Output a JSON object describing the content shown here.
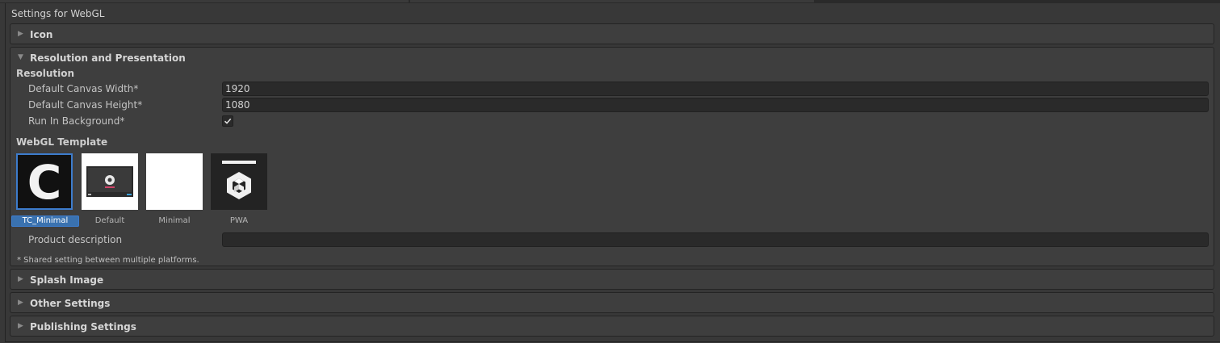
{
  "window_title": "Settings for WebGL",
  "sections": {
    "icon": {
      "title": "Icon",
      "expanded": false
    },
    "resolution": {
      "title": "Resolution and Presentation",
      "expanded": true,
      "resolution_heading": "Resolution",
      "canvas_width_label": "Default Canvas Width*",
      "canvas_width_value": "1920",
      "canvas_height_label": "Default Canvas Height*",
      "canvas_height_value": "1080",
      "run_in_background_label": "Run In Background*",
      "run_in_background_checked": true,
      "webgl_template_heading": "WebGL Template",
      "templates": [
        {
          "label": "TC_Minimal",
          "selected": true,
          "icon": "letter-c-thumbnail"
        },
        {
          "label": "Default",
          "selected": false,
          "icon": "default-template-thumbnail"
        },
        {
          "label": "Minimal",
          "selected": false,
          "icon": "blank-white-thumbnail"
        },
        {
          "label": "PWA",
          "selected": false,
          "icon": "unity-logo-thumbnail"
        }
      ],
      "product_description_label": "Product description",
      "product_description_value": "",
      "footnote": "* Shared setting between multiple platforms."
    },
    "splash": {
      "title": "Splash Image",
      "expanded": false
    },
    "other": {
      "title": "Other Settings",
      "expanded": false
    },
    "publishing": {
      "title": "Publishing Settings",
      "expanded": false
    }
  },
  "colors": {
    "background": "#383838",
    "section_bg": "#3e3e3e",
    "field_bg": "#2a2a2a",
    "selection_blue": "#3a72b0",
    "text": "#c4c4c4"
  }
}
